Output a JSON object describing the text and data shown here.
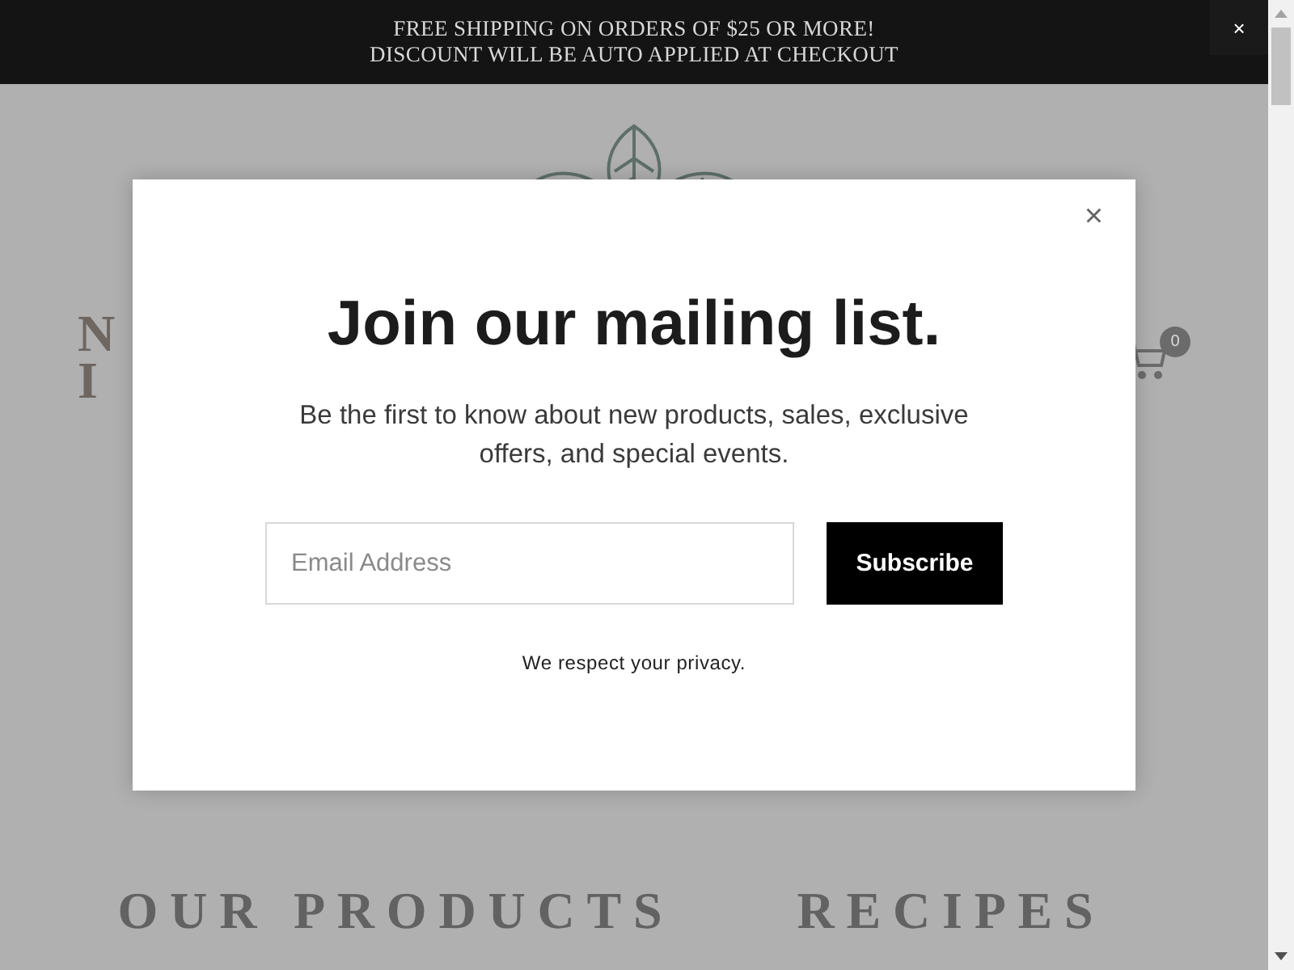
{
  "announcement": {
    "lines": [
      "FREE SHIPPING ON ORDERS OF $25 OR MORE!",
      "DISCOUNT WILL BE AUTO APPLIED AT CHECKOUT"
    ],
    "close": "×"
  },
  "header": {
    "logo_text": [
      "N",
      "I"
    ],
    "cart_count": "0"
  },
  "nav": [
    {
      "label": "OUR PRODUCTS"
    },
    {
      "label": "RECIPES"
    }
  ],
  "modal": {
    "close": "×",
    "title": "Join our mailing list.",
    "description": "Be the first to know about new products, sales, exclusive offers, and special events.",
    "email": {
      "placeholder": "Email Address"
    },
    "button": "Subscribe",
    "privacy": "We respect your privacy."
  }
}
